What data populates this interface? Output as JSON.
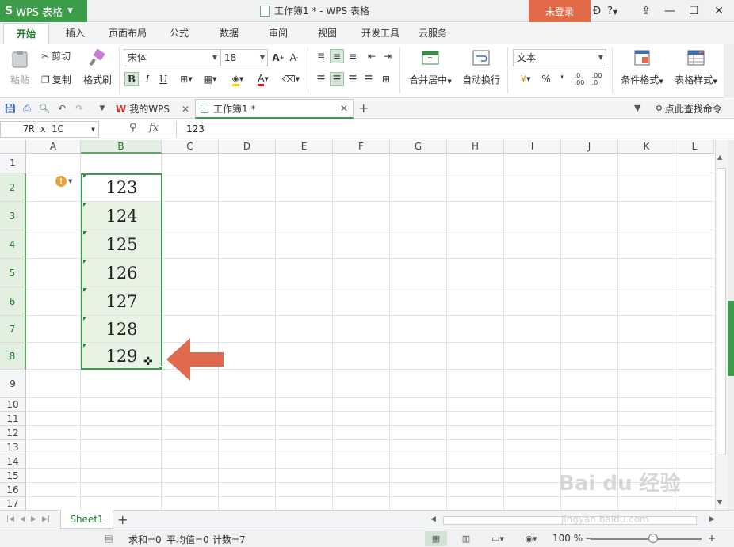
{
  "titlebar": {
    "app_name": "WPS 表格",
    "window_title": "工作簿1 * - WPS 表格",
    "login": "未登录",
    "help": "?"
  },
  "ribbon_tabs": [
    "开始",
    "插入",
    "页面布局",
    "公式",
    "数据",
    "审阅",
    "视图",
    "开发工具",
    "云服务"
  ],
  "ribbon": {
    "paste": "粘贴",
    "cut": "剪切",
    "copy": "复制",
    "format_painter": "格式刷",
    "font_name": "宋体",
    "font_size": "18",
    "bold": "B",
    "italic": "I",
    "underline": "U",
    "merge_center": "合并居中",
    "wrap_text": "自动换行",
    "number_format": "文本",
    "percent": "%",
    "comma": "❜",
    "conditional_format": "条件格式",
    "table_style": "表格样式"
  },
  "doc_tabs": {
    "my_wps": "我的WPS",
    "workbook": "工作簿1 *",
    "find_command": "点此查找命令"
  },
  "formula_bar": {
    "name_box": "7R x 1C",
    "fx": "fx",
    "value": "123"
  },
  "columns": [
    "A",
    "B",
    "C",
    "D",
    "E",
    "F",
    "G",
    "H",
    "I",
    "J",
    "K",
    "L"
  ],
  "rows": [
    "1",
    "2",
    "3",
    "4",
    "5",
    "6",
    "7",
    "8",
    "9",
    "10",
    "11",
    "12",
    "13",
    "14",
    "15",
    "16",
    "17"
  ],
  "cells_B": [
    "123",
    "124",
    "125",
    "126",
    "127",
    "128",
    "129"
  ],
  "sheet": {
    "name": "Sheet1"
  },
  "status": {
    "sum": "求和=0",
    "average": "平均值=0",
    "count": "计数=7",
    "zoom": "100 %"
  },
  "watermark": {
    "brand": "Bai du 经验",
    "url": "jingyan.baidu.com"
  },
  "colors": {
    "accent": "#3c9c4a",
    "login": "#e36a48",
    "arrow": "#e06a4e"
  }
}
